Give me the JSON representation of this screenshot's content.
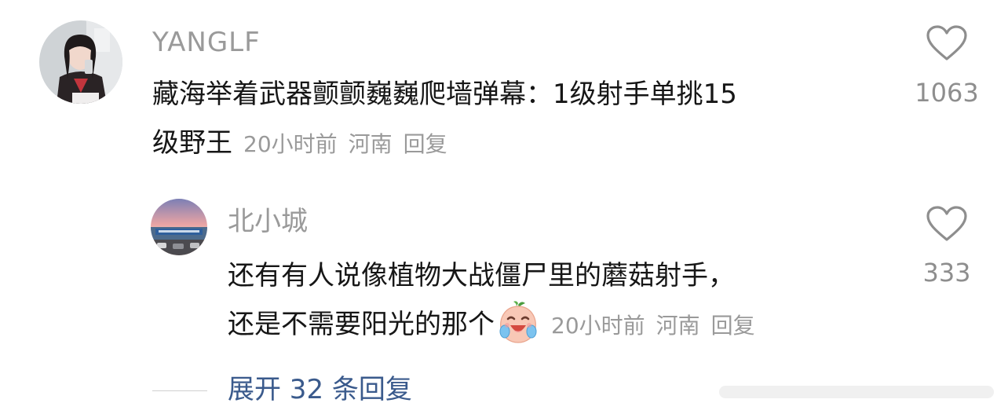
{
  "comments": [
    {
      "username": "YANGLF",
      "content_line1": "藏海举着武器颤颤巍巍爬墙弹幕：1级射手单挑15",
      "content_line2": "级野王",
      "time": "20小时前",
      "location": "河南",
      "reply_label": "回复",
      "likes": "1063"
    },
    {
      "username": "北小城",
      "content_line1": "还有有人说像植物大战僵尸里的蘑菇射手，",
      "content_line2": "还是不需要阳光的那个",
      "emoji": "laughing-crying-peach-emoji",
      "time": "20小时前",
      "location": "河南",
      "reply_label": "回复",
      "likes": "333"
    }
  ],
  "expand_replies": "展开 32 条回复",
  "colors": {
    "username": "#9a9a9a",
    "content": "#161616",
    "meta": "#9a9a9a",
    "link": "#3a5a8c"
  }
}
